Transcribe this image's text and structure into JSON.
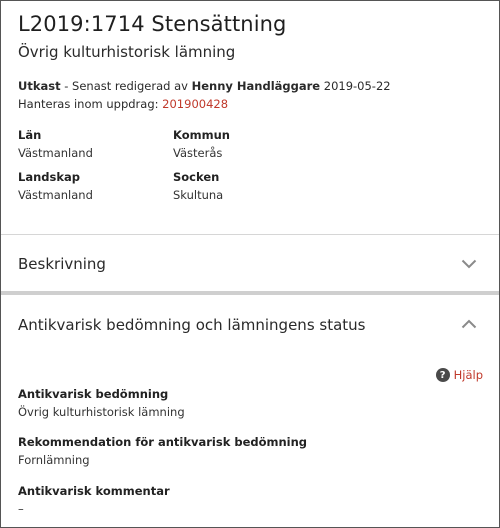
{
  "header": {
    "title": "L2019:1714 Stensättning",
    "subtitle": "Övrig kulturhistorisk lämning",
    "status": "Utkast",
    "edited_prefix": " - Senast redigerad av ",
    "editor": "Henny Handläggare",
    "edited_date": " 2019-05-22",
    "assignment_label": "Hanteras inom uppdrag: ",
    "assignment_id": "201900428"
  },
  "location": {
    "lan_label": "Län",
    "lan_value": "Västmanland",
    "kommun_label": "Kommun",
    "kommun_value": "Västerås",
    "landskap_label": "Landskap",
    "landskap_value": "Västmanland",
    "socken_label": "Socken",
    "socken_value": "Skultuna"
  },
  "sections": {
    "beskrivning": {
      "title": "Beskrivning",
      "expanded": false
    },
    "antikvarisk": {
      "title": "Antikvarisk bedömning och lämningens status",
      "expanded": true,
      "help_label": "Hjälp",
      "help_icon": "question-circle-icon",
      "bedomning_label": "Antikvarisk bedömning",
      "bedomning_value": "Övrig kulturhistorisk lämning",
      "rekommendation_label": "Rekommendation för antikvarisk bedömning",
      "rekommendation_value": "Fornlämning",
      "kommentar_label": "Antikvarisk kommentar",
      "kommentar_value": "–"
    }
  },
  "colors": {
    "link": "#c0392b",
    "chevron": "#8a8a8a"
  }
}
